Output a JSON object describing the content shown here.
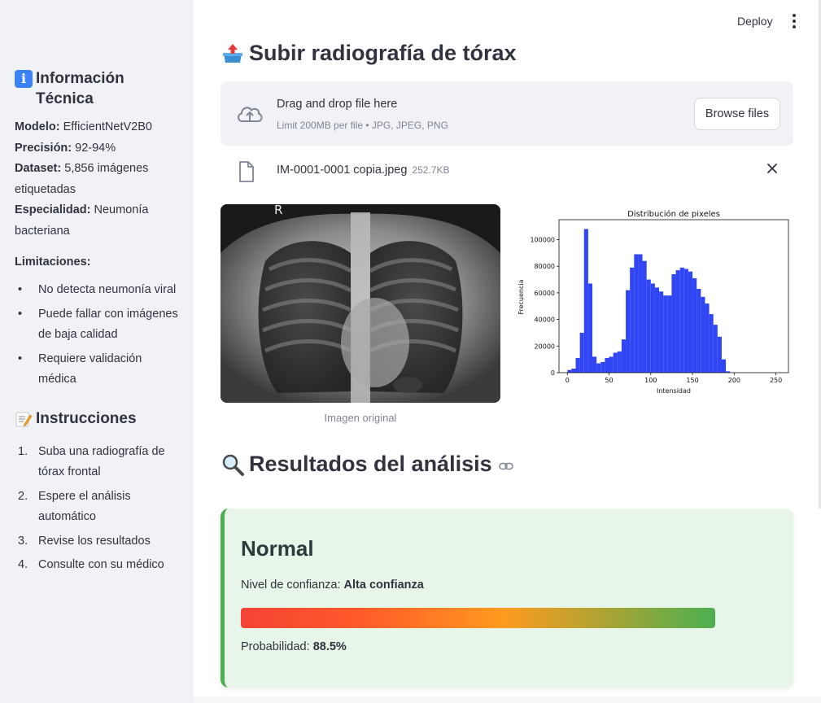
{
  "sidebar": {
    "info_title": "Información Técnica",
    "info_icon": "information-icon",
    "model_label": "Modelo:",
    "model_value": "EfficientNetV2B0",
    "precision_label": "Precisión:",
    "precision_value": "92-94%",
    "dataset_label": "Dataset:",
    "dataset_value": "5,856 imágenes etiquetadas",
    "specialty_label": "Especialidad:",
    "specialty_value": "Neumonía bacteriana",
    "limitations_title": "Limitaciones:",
    "limitations": [
      "No detecta neumonía viral",
      "Puede fallar con imágenes de baja calidad",
      "Requiere validación médica"
    ],
    "instructions_title": "Instrucciones",
    "instructions_icon": "memo-icon",
    "instructions": [
      "Suba una radiografía de tórax frontal",
      "Espere el análisis automático",
      "Revise los resultados",
      "Consulte con su médico"
    ]
  },
  "topbar": {
    "deploy_label": "Deploy"
  },
  "upload": {
    "title": "Subir radiografía de tórax",
    "title_icon": "outbox-tray-icon",
    "drop_title": "Drag and drop file here",
    "drop_subtitle": "Limit 200MB per file • JPG, JPEG, PNG",
    "browse_label": "Browse files",
    "file_name": "IM-0001-0001 copia.jpeg",
    "file_size": "252.7KB"
  },
  "image": {
    "caption": "Imagen original",
    "marker": "R"
  },
  "chart_data": {
    "type": "bar",
    "title": "Distribución de pixeles",
    "xlabel": "Intensidad",
    "ylabel": "Frecuencia",
    "xlim": [
      -10,
      265
    ],
    "ylim": [
      0,
      115000
    ],
    "xticks": [
      0,
      50,
      100,
      150,
      200,
      250
    ],
    "yticks": [
      0,
      20000,
      40000,
      60000,
      80000,
      100000
    ],
    "bin_width": 5,
    "bins": [
      0,
      5,
      10,
      15,
      20,
      25,
      30,
      35,
      40,
      45,
      50,
      55,
      60,
      65,
      70,
      75,
      80,
      85,
      90,
      95,
      100,
      105,
      110,
      115,
      120,
      125,
      130,
      135,
      140,
      145,
      150,
      155,
      160,
      165,
      170,
      175,
      180,
      185,
      190,
      195,
      200,
      205,
      210,
      215,
      220,
      225,
      230,
      235,
      240,
      245,
      250
    ],
    "values": [
      2000,
      3000,
      11000,
      30000,
      108000,
      67000,
      12000,
      7000,
      8000,
      11000,
      12000,
      15000,
      16000,
      25000,
      62000,
      79000,
      89000,
      89000,
      84000,
      70000,
      67000,
      64000,
      61000,
      58000,
      58000,
      74000,
      77000,
      79000,
      78000,
      76000,
      71000,
      63000,
      57000,
      52000,
      44000,
      36000,
      27000,
      10000,
      1000,
      0,
      0
    ],
    "bar_color": "#3046f5"
  },
  "results": {
    "title": "Resultados del análisis",
    "title_icon": "magnifying-glass-icon",
    "link_icon": "link-icon",
    "diagnosis": "Normal",
    "confidence_label": "Nivel de confianza:",
    "confidence_value": "Alta confianza",
    "probability_label": "Probabilidad:",
    "probability_value": "88.5%",
    "probability_fraction": 0.885,
    "accent_color": "#4caf50"
  }
}
